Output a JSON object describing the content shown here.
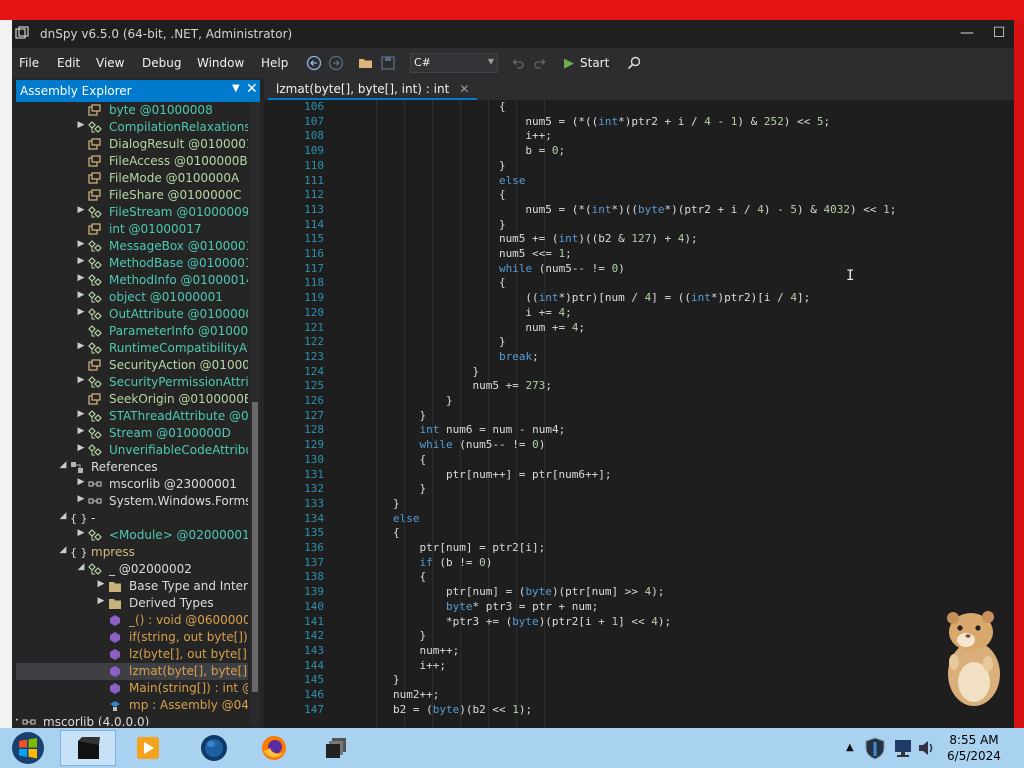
{
  "window": {
    "title": "dnSpy v6.5.0 (64-bit, .NET, Administrator)",
    "minimize": "—",
    "maximize": "☐"
  },
  "menu": [
    "File",
    "Edit",
    "View",
    "Debug",
    "Window",
    "Help"
  ],
  "toolbar": {
    "language": "C#",
    "start_label": "Start"
  },
  "assembly_explorer": {
    "title": "Assembly Explorer",
    "items": [
      {
        "exp": "",
        "icon": "enum",
        "label": "byte @01000008",
        "indent": 0,
        "color": "c-type"
      },
      {
        "exp": "▶",
        "icon": "class",
        "label": "CompilationRelaxationsAt",
        "indent": 0,
        "color": "c-type"
      },
      {
        "exp": "",
        "icon": "enum",
        "label": "DialogResult @01000013",
        "indent": 0,
        "color": "c-enum"
      },
      {
        "exp": "",
        "icon": "enum",
        "label": "FileAccess @0100000B",
        "indent": 0,
        "color": "c-enum"
      },
      {
        "exp": "",
        "icon": "enum",
        "label": "FileMode @0100000A",
        "indent": 0,
        "color": "c-enum"
      },
      {
        "exp": "",
        "icon": "enum",
        "label": "FileShare @0100000C",
        "indent": 0,
        "color": "c-enum"
      },
      {
        "exp": "▶",
        "icon": "class",
        "label": "FileStream @01000009",
        "indent": 0,
        "color": "c-type"
      },
      {
        "exp": "",
        "icon": "enum",
        "label": "int @01000017",
        "indent": 0,
        "color": "c-type"
      },
      {
        "exp": "▶",
        "icon": "class",
        "label": "MessageBox @01000012",
        "indent": 0,
        "color": "c-type"
      },
      {
        "exp": "▶",
        "icon": "class",
        "label": "MethodBase @01000015",
        "indent": 0,
        "color": "c-type"
      },
      {
        "exp": "▶",
        "icon": "class",
        "label": "MethodInfo @01000014",
        "indent": 0,
        "color": "c-type"
      },
      {
        "exp": "▶",
        "icon": "class",
        "label": "object @01000001",
        "indent": 0,
        "color": "c-type"
      },
      {
        "exp": "▶",
        "icon": "class",
        "label": "OutAttribute @01000003",
        "indent": 0,
        "color": "c-type"
      },
      {
        "exp": "",
        "icon": "class",
        "label": "ParameterInfo @01000016",
        "indent": 0,
        "color": "c-type"
      },
      {
        "exp": "▶",
        "icon": "class",
        "label": "RuntimeCompatibilityAttri",
        "indent": 0,
        "color": "c-type"
      },
      {
        "exp": "",
        "icon": "enum",
        "label": "SecurityAction @0100000",
        "indent": 0,
        "color": "c-enum"
      },
      {
        "exp": "▶",
        "icon": "class",
        "label": "SecurityPermissionAttribu",
        "indent": 0,
        "color": "c-type"
      },
      {
        "exp": "",
        "icon": "enum",
        "label": "SeekOrigin @0100000E",
        "indent": 0,
        "color": "c-enum"
      },
      {
        "exp": "▶",
        "icon": "class",
        "label": "STAThreadAttribute @010",
        "indent": 0,
        "color": "c-type"
      },
      {
        "exp": "▶",
        "icon": "class",
        "label": "Stream @0100000D",
        "indent": 0,
        "color": "c-type"
      },
      {
        "exp": "▶",
        "icon": "class",
        "label": "UnverifiableCodeAttribute",
        "indent": 0,
        "color": "c-type"
      },
      {
        "exp": "◢",
        "icon": "refs",
        "label": "References",
        "indent": -1,
        "color": "c-white"
      },
      {
        "exp": "▶",
        "icon": "ref",
        "label": "mscorlib @23000001",
        "indent": 0,
        "color": "c-white"
      },
      {
        "exp": "▶",
        "icon": "ref",
        "label": "System.Windows.Forms @",
        "indent": 0,
        "color": "c-white"
      },
      {
        "exp": "◢",
        "icon": "ns",
        "label": "-",
        "indent": -1,
        "color": "c-white"
      },
      {
        "exp": "▶",
        "icon": "class",
        "label": "<Module> @02000001",
        "indent": 0,
        "color": "c-type"
      },
      {
        "exp": "◢",
        "icon": "ns",
        "label": "mpress",
        "indent": -1,
        "color": "c-ns"
      },
      {
        "exp": "◢",
        "icon": "class",
        "label": "_ @02000002",
        "indent": 0,
        "color": "c-white"
      },
      {
        "exp": "▶",
        "icon": "folder",
        "label": "Base Type and Interfac",
        "indent": 1,
        "color": "c-white"
      },
      {
        "exp": "▶",
        "icon": "folder",
        "label": "Derived Types",
        "indent": 1,
        "color": "c-white"
      },
      {
        "exp": "",
        "icon": "method",
        "label": "_() : void @06000005",
        "indent": 1,
        "color": "c-meth"
      },
      {
        "exp": "",
        "icon": "method",
        "label": "if(string, out byte[]) : b",
        "indent": 1,
        "color": "c-meth"
      },
      {
        "exp": "",
        "icon": "method",
        "label": "lz(byte[], out byte[], in",
        "indent": 1,
        "color": "c-meth"
      },
      {
        "exp": "",
        "icon": "method",
        "label": "lzmat(byte[], byte[], in",
        "indent": 1,
        "color": "c-meth",
        "selected": true
      },
      {
        "exp": "",
        "icon": "method",
        "label": "Main(string[]) : int @0",
        "indent": 1,
        "color": "c-meth"
      },
      {
        "exp": "",
        "icon": "field",
        "label": "mp : Assembly @0400",
        "indent": 1,
        "color": "c-meth"
      },
      {
        "exp": "▶",
        "icon": "ref",
        "label": "mscorlib (4.0.0.0)",
        "indent": -2,
        "color": "c-white"
      }
    ]
  },
  "editor": {
    "tab_title": "lzmat(byte[], byte[], int) : int",
    "lines": [
      {
        "n": "106",
        "code": "                        {"
      },
      {
        "n": "107",
        "code": "                            num5 = (*((int*)ptr2 + i / 4 - 1) & 252) << 5;"
      },
      {
        "n": "108",
        "code": "                            i++;"
      },
      {
        "n": "109",
        "code": "                            b = 0;"
      },
      {
        "n": "110",
        "code": "                        }"
      },
      {
        "n": "111",
        "code": "                        else"
      },
      {
        "n": "112",
        "code": "                        {"
      },
      {
        "n": "113",
        "code": "                            num5 = (*(int*)((byte*)(ptr2 + i / 4) - 5) & 4032) << 1;"
      },
      {
        "n": "114",
        "code": "                        }"
      },
      {
        "n": "115",
        "code": "                        num5 += (int)((b2 & 127) + 4);"
      },
      {
        "n": "116",
        "code": "                        num5 <<= 1;"
      },
      {
        "n": "117",
        "code": "                        while (num5-- != 0)"
      },
      {
        "n": "118",
        "code": "                        {"
      },
      {
        "n": "119",
        "code": "                            ((int*)ptr)[num / 4] = ((int*)ptr2)[i / 4];"
      },
      {
        "n": "120",
        "code": "                            i += 4;"
      },
      {
        "n": "121",
        "code": "                            num += 4;"
      },
      {
        "n": "122",
        "code": "                        }"
      },
      {
        "n": "123",
        "code": "                        break;"
      },
      {
        "n": "124",
        "code": "                    }"
      },
      {
        "n": "125",
        "code": "                    num5 += 273;"
      },
      {
        "n": "126",
        "code": "                }"
      },
      {
        "n": "127",
        "code": "            }"
      },
      {
        "n": "128",
        "code": "            int num6 = num - num4;"
      },
      {
        "n": "129",
        "code": "            while (num5-- != 0)"
      },
      {
        "n": "130",
        "code": "            {"
      },
      {
        "n": "131",
        "code": "                ptr[num++] = ptr[num6++];"
      },
      {
        "n": "132",
        "code": "            }"
      },
      {
        "n": "133",
        "code": "        }"
      },
      {
        "n": "134",
        "code": "        else"
      },
      {
        "n": "135",
        "code": "        {"
      },
      {
        "n": "136",
        "code": "            ptr[num] = ptr2[i];"
      },
      {
        "n": "137",
        "code": "            if (b != 0)"
      },
      {
        "n": "138",
        "code": "            {"
      },
      {
        "n": "139",
        "code": "                ptr[num] = (byte)(ptr[num] >> 4);"
      },
      {
        "n": "140",
        "code": "                byte* ptr3 = ptr + num;"
      },
      {
        "n": "141",
        "code": "                *ptr3 += (byte)(ptr2[i + 1] << 4);"
      },
      {
        "n": "142",
        "code": "            }"
      },
      {
        "n": "143",
        "code": "            num++;"
      },
      {
        "n": "144",
        "code": "            i++;"
      },
      {
        "n": "145",
        "code": "        }"
      },
      {
        "n": "146",
        "code": "        num2++;"
      },
      {
        "n": "147",
        "code": "        b2 = (byte)(b2 << 1);"
      }
    ]
  },
  "taskbar": {
    "time": "8:55 AM",
    "date": "6/5/2024"
  },
  "colors": {
    "accent": "#007acc",
    "keyword": "#569cd6",
    "number": "#b5cea8",
    "line_number": "#2b91af"
  }
}
